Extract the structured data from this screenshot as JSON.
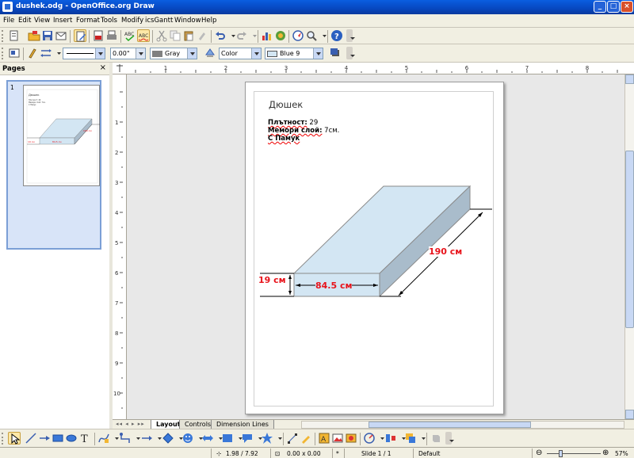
{
  "window": {
    "title": "dushek.odg - OpenOffice.org Draw"
  },
  "menu": [
    "File",
    "Edit",
    "View",
    "Insert",
    "Format",
    "Tools",
    "Modify",
    "icsGantt",
    "Window",
    "Help"
  ],
  "linebar": {
    "width": "0.00\"",
    "line_color": "Gray",
    "area_style": "Color",
    "area_color": "Blue 9"
  },
  "pages_panel": {
    "title": "Pages",
    "page_number": "1"
  },
  "document": {
    "title": "Дюшек",
    "lines": [
      {
        "label": "Плътност:",
        "value": " 29"
      },
      {
        "label": "Мемори слой:",
        "value": " 7см."
      },
      {
        "label": "С Памук",
        "value": ""
      }
    ],
    "dim_height": "19 см",
    "dim_width": "84.5 см",
    "dim_length": "190 см"
  },
  "tabs": [
    "Layout",
    "Controls",
    "Dimension Lines"
  ],
  "status": {
    "position": "1.98 / 7.92",
    "size": "0.00 x 0.00",
    "modified": "*",
    "slide": "Slide 1 / 1",
    "layout": "Default",
    "zoom": "57%"
  },
  "colors": {
    "box_fill": "#d3e6f3",
    "dim_red": "#e8131b",
    "title_blue": "#0a5ee0"
  }
}
